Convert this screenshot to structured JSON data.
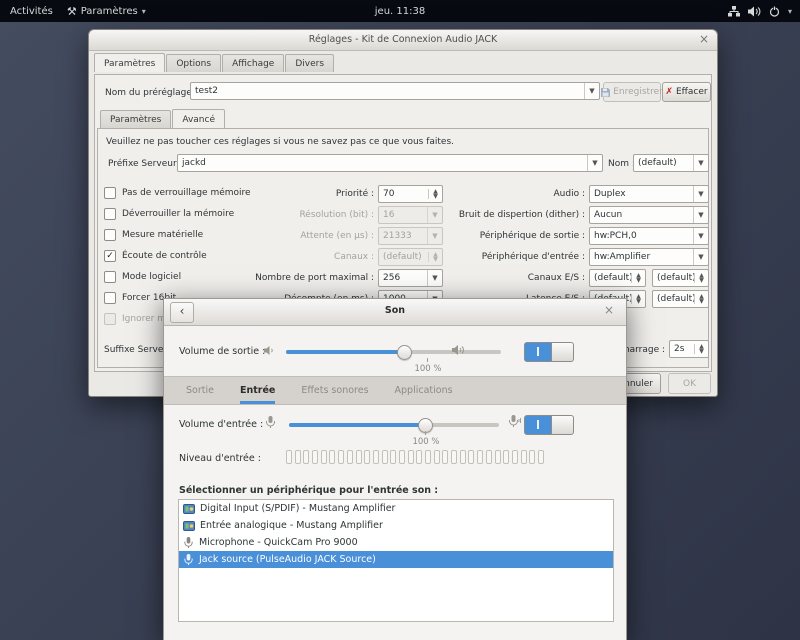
{
  "topbar": {
    "activities": "Activités",
    "app_menu": "Paramètres",
    "clock": "jeu. 11:38"
  },
  "colors": {
    "accent": "#4a90d9",
    "danger": "#c11e1e"
  },
  "jack_dialog": {
    "title": "Réglages - Kit de Connexion Audio JACK",
    "close": "×",
    "tabs": {
      "parametres": "Paramètres",
      "options": "Options",
      "affichage": "Affichage",
      "divers": "Divers"
    },
    "preset": {
      "label": "Nom du préréglage :",
      "value": "test2",
      "save": "Enregistrer",
      "delete": "Effacer"
    },
    "subtabs": {
      "parametres": "Paramètres",
      "avance": "Avancé"
    },
    "warning": "Veuillez ne pas toucher ces réglages si vous ne savez pas ce que vous faites.",
    "server_prefix_label": "Préfixe Serveur :",
    "server_prefix_value": "jackd",
    "server_name_label": "Nom :",
    "server_name_value": "(default)",
    "checkboxes": [
      {
        "label": "Pas de verrouillage mémoire",
        "checked": false,
        "disabled": false
      },
      {
        "label": "Déverrouiller la mémoire",
        "checked": false,
        "disabled": false
      },
      {
        "label": "Mesure matérielle",
        "checked": false,
        "disabled": false
      },
      {
        "label": "Écoute de contrôle",
        "checked": true,
        "disabled": false
      },
      {
        "label": "Mode logiciel",
        "checked": false,
        "disabled": false
      },
      {
        "label": "Forcer 16bit",
        "checked": false,
        "disabled": false
      },
      {
        "label": "Ignorer matériel",
        "checked": false,
        "disabled": true
      }
    ],
    "mid_fields": [
      {
        "label": "Priorité :",
        "value": "70",
        "disabled": false
      },
      {
        "label": "Résolution (bit) :",
        "value": "16",
        "disabled": true
      },
      {
        "label": "Attente (en µs) :",
        "value": "21333",
        "disabled": true
      },
      {
        "label": "Canaux :",
        "value": "(default)",
        "disabled": true
      },
      {
        "label": "Nombre de port maximal :",
        "value": "256",
        "disabled": false
      },
      {
        "label": "Décompte (en ms) :",
        "value": "1000",
        "disabled": false
      }
    ],
    "right_fields": [
      {
        "label": "Audio :",
        "value": "Duplex"
      },
      {
        "label": "Bruit de dispertion (dither) :",
        "value": "Aucun"
      },
      {
        "label": "Périphérique de sortie :",
        "value": "hw:PCH,0"
      },
      {
        "label": "Périphérique d'entrée :",
        "value": "hw:Amplifier"
      }
    ],
    "dual_fields": [
      {
        "label": "Canaux E/S :",
        "v1": "(default)",
        "v2": "(default)"
      },
      {
        "label": "Latence E/S :",
        "v1": "(default)",
        "v2": "(default)"
      }
    ],
    "server_suffix_label": "Suffixe Serveur :",
    "startup_label": "Délai de démarrage :",
    "startup_value": "2s",
    "buttons": {
      "cancel": "Annuler",
      "ok": "OK"
    }
  },
  "sound_dialog": {
    "title": "Son",
    "back": "‹",
    "close": "×",
    "output_volume_label": "Volume de sortie :",
    "output_volume_percent": "100 %",
    "tabs": [
      "Sortie",
      "Entrée",
      "Effets sonores",
      "Applications"
    ],
    "active_tab": "Entrée",
    "input_volume_label": "Volume d'entrée :",
    "input_volume_percent": "100 %",
    "input_level_label": "Niveau d'entrée :",
    "level_segments": 30,
    "device_select_label": "Sélectionner un périphérique pour l'entrée son :",
    "devices": [
      {
        "label": "Digital Input (S/PDIF) - Mustang Amplifier",
        "icon": "soundcard",
        "selected": false
      },
      {
        "label": "Entrée analogique - Mustang Amplifier",
        "icon": "soundcard",
        "selected": false
      },
      {
        "label": "Microphone - QuickCam Pro 9000",
        "icon": "microphone",
        "selected": false
      },
      {
        "label": "Jack source (PulseAudio JACK Source)",
        "icon": "microphone",
        "selected": true
      }
    ]
  }
}
